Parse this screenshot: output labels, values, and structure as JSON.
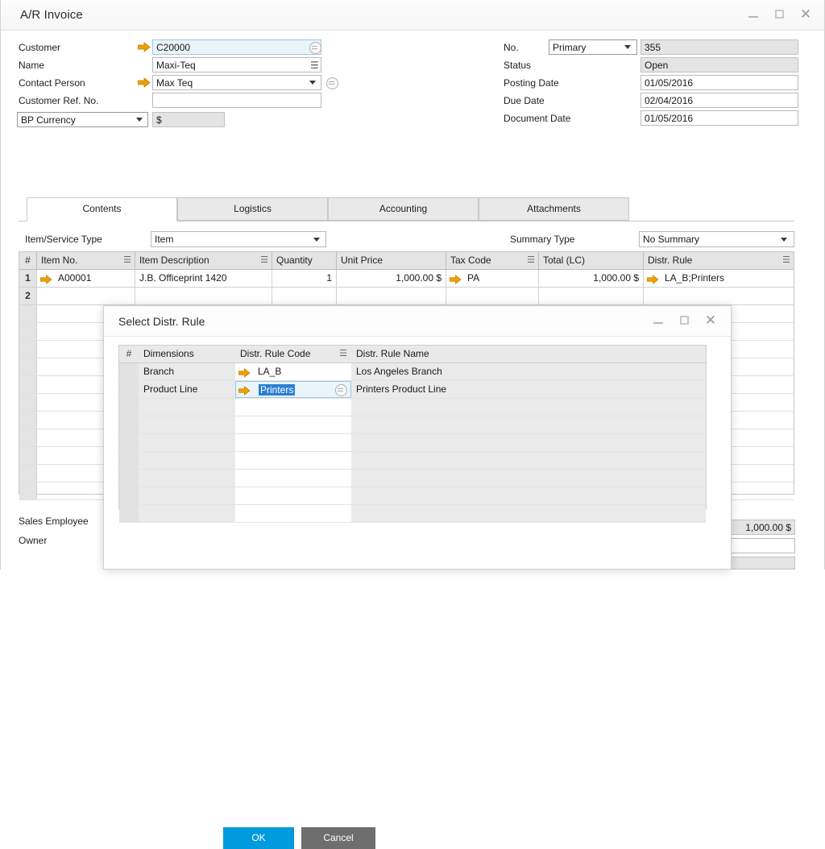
{
  "window": {
    "title": "A/R Invoice",
    "controls": {
      "minimize": "—",
      "maximize": "▢",
      "close": "✕"
    }
  },
  "header_left": {
    "fields": [
      {
        "label": "Customer",
        "value": "C20000",
        "state": "active",
        "has_arrow": true,
        "widget": "lookup"
      },
      {
        "label": "Name",
        "value": "Maxi-Teq",
        "state": "normal",
        "has_arrow": false,
        "widget": "hamburger"
      },
      {
        "label": "Contact Person",
        "value": "Max Teq",
        "state": "normal",
        "has_arrow": true,
        "widget": "dropdown-link"
      },
      {
        "label": "Customer Ref. No.",
        "value": "",
        "state": "normal",
        "has_arrow": false,
        "widget": "none"
      }
    ],
    "currency_select": "BP Currency",
    "currency_value": "$"
  },
  "header_right": {
    "fields": [
      {
        "label": "No.",
        "value": "355",
        "state": "readonly",
        "select": "Primary"
      },
      {
        "label": "Status",
        "value": "Open",
        "state": "readonly",
        "select": null
      },
      {
        "label": "Posting Date",
        "value": "01/05/2016",
        "state": "normal",
        "select": null
      },
      {
        "label": "Due Date",
        "value": "02/04/2016",
        "state": "normal",
        "select": null
      },
      {
        "label": "Document Date",
        "value": "01/05/2016",
        "state": "normal",
        "select": null
      }
    ]
  },
  "tabs": {
    "items": [
      "Contents",
      "Logistics",
      "Accounting",
      "Attachments"
    ],
    "selected_index": 0
  },
  "toolbar": {
    "item_service_type_label": "Item/Service Type",
    "item_service_type_value": "Item",
    "summary_type_label": "Summary Type",
    "summary_type_value": "No Summary"
  },
  "grid": {
    "columns": [
      "#",
      "Item No.",
      "Item Description",
      "Quantity",
      "Unit Price",
      "Tax Code",
      "Total (LC)",
      "Distr. Rule"
    ],
    "rows": [
      {
        "index": "1",
        "item_no": "A00001",
        "item_description": "J.B. Officeprint 1420",
        "quantity": "1",
        "unit_price": "1,000.00 $",
        "tax_code": "PA",
        "total_lc": "1,000.00 $",
        "distr_rule": "LA_B;Printers"
      },
      {
        "index": "2",
        "item_no": "",
        "item_description": "",
        "quantity": "",
        "unit_price": "",
        "tax_code": "",
        "total_lc": "",
        "distr_rule": ""
      }
    ],
    "empty_row_count": 11
  },
  "footer": {
    "sales_employee_label": "Sales Employee",
    "owner_label": "Owner",
    "total_value": "1,000.00 $"
  },
  "modal": {
    "title": "Select Distr. Rule",
    "controls": {
      "minimize": "—",
      "maximize": "▢",
      "close": "✕"
    },
    "columns": [
      "#",
      "Dimensions",
      "Distr.  Rule Code",
      "Distr.  Rule Name"
    ],
    "rows": [
      {
        "index": "",
        "dimension": "Branch",
        "rule_code": "LA_B",
        "rule_name": "Los Angeles Branch",
        "selected": false
      },
      {
        "index": "",
        "dimension": "Product Line",
        "rule_code": "Printers",
        "rule_name": "Printers Product Line",
        "selected": true
      }
    ],
    "empty_row_count": 7,
    "ok_label": "OK",
    "cancel_label": "Cancel"
  },
  "colors": {
    "accent": "#009ade",
    "cancel": "#6e6e6e",
    "arrow": "#f0a000",
    "selection": "#2a7fd4",
    "grid_header": "#e4e4e4"
  }
}
